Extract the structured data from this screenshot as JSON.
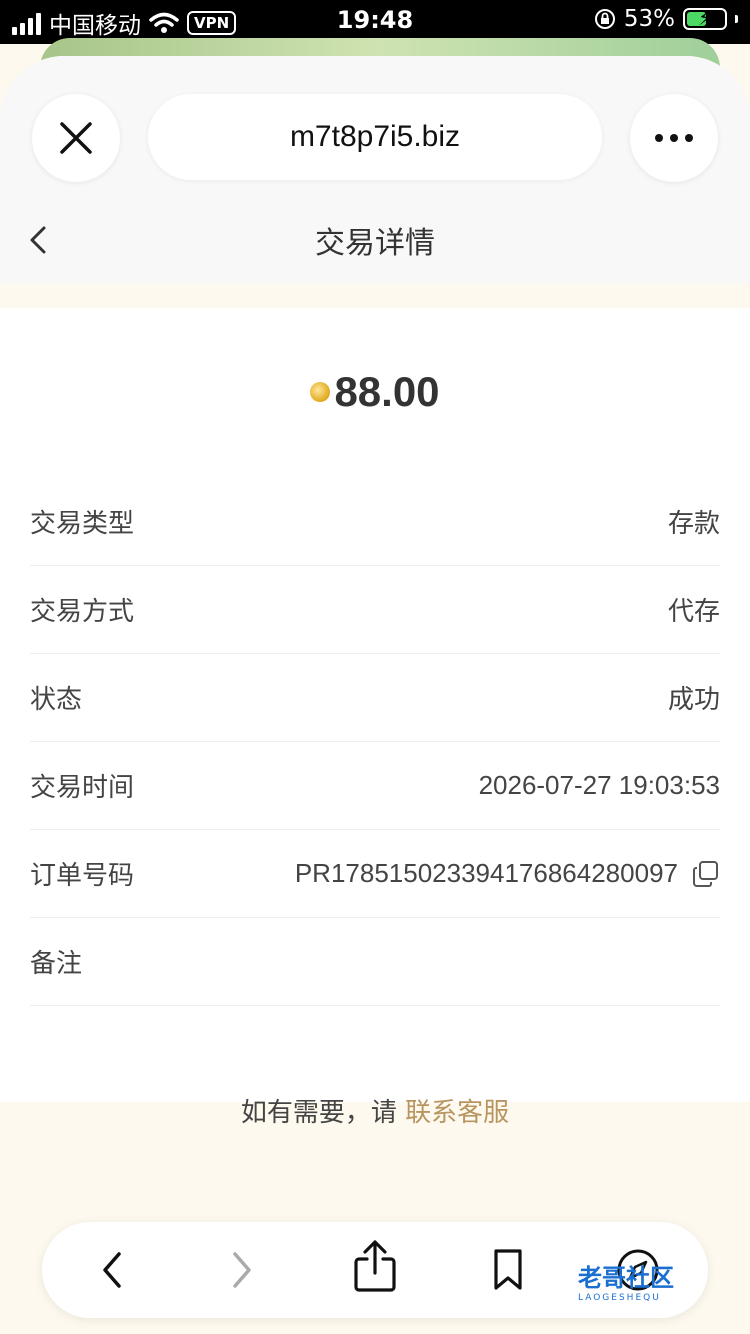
{
  "status_bar": {
    "carrier": "中国移动",
    "vpn": "VPN",
    "time": "19:48",
    "battery_percent": "53%",
    "battery_level": 0.53
  },
  "browser": {
    "url": "m7t8p7i5.biz"
  },
  "page": {
    "title": "交易详情"
  },
  "amount": "88.00",
  "details": [
    {
      "label": "交易类型",
      "value": "存款"
    },
    {
      "label": "交易方式",
      "value": "代存"
    },
    {
      "label": "状态",
      "value": "成功"
    },
    {
      "label": "交易时间",
      "value": "2026-07-27 19:03:53"
    },
    {
      "label": "订单号码",
      "value": "PR178515023394176864280097"
    },
    {
      "label": "备注",
      "value": ""
    }
  ],
  "help": {
    "prefix": "如有需要，请 ",
    "link": "联系客服"
  },
  "watermark": {
    "text": "老哥社区",
    "sub": "LAOGESHEQU"
  },
  "colors": {
    "accent_link": "#b89560",
    "page_bg": "#fdf9ee",
    "battery_fill": "#4cd964"
  }
}
